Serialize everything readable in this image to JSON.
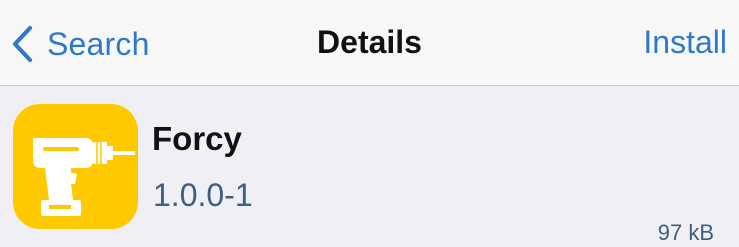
{
  "navbar": {
    "back_label": "Search",
    "title": "Details",
    "action_label": "Install"
  },
  "package": {
    "name": "Forcy",
    "version": "1.0.0-1",
    "size": "97 kB",
    "icon": "power-drill-icon",
    "icon_background": "#ffc900"
  },
  "colors": {
    "accent": "#2f79c8",
    "detail_text": "#3d5f80",
    "background": "#efeff4",
    "navbar_background": "#f7f7f8"
  }
}
